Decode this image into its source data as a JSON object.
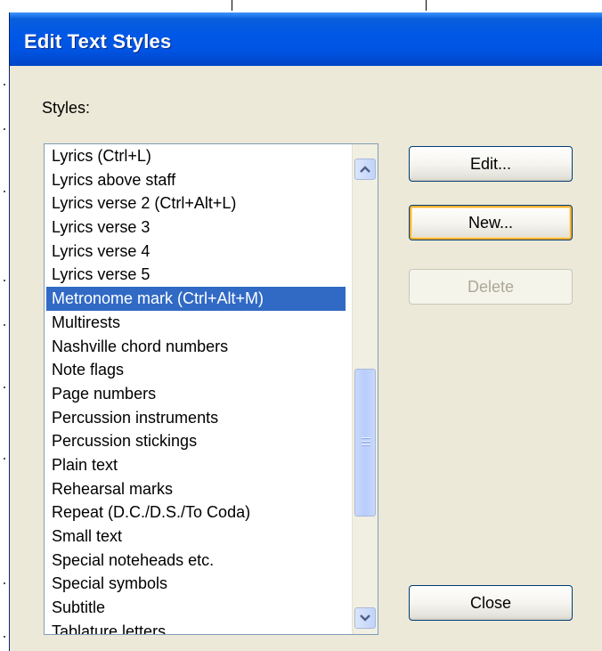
{
  "dialog": {
    "title": "Edit Text Styles",
    "styles_label": "Styles:"
  },
  "list": {
    "selected_index": 6,
    "items": [
      "Lyrics (Ctrl+L)",
      "Lyrics above staff",
      "Lyrics verse 2 (Ctrl+Alt+L)",
      "Lyrics verse 3",
      "Lyrics verse 4",
      "Lyrics verse 5",
      "Metronome mark (Ctrl+Alt+M)",
      "Multirests",
      "Nashville chord numbers",
      "Note flags",
      "Page numbers",
      "Percussion instruments",
      "Percussion stickings",
      "Plain text",
      "Rehearsal marks",
      "Repeat (D.C./D.S./To Coda)",
      "Small text",
      "Special noteheads etc.",
      "Special symbols",
      "Subtitle",
      "Tablature letters"
    ]
  },
  "buttons": {
    "edit": "Edit...",
    "new": "New...",
    "delete": "Delete",
    "close": "Close"
  },
  "scrollbar": {
    "up_icon": "chevron-up-icon",
    "down_icon": "chevron-down-icon",
    "thumb_position_fraction": 0.48
  },
  "colors": {
    "titlebar": "#0054e3",
    "selection": "#316ac5",
    "dialog_bg": "#ece9d8",
    "focus_ring": "#f8b030"
  }
}
